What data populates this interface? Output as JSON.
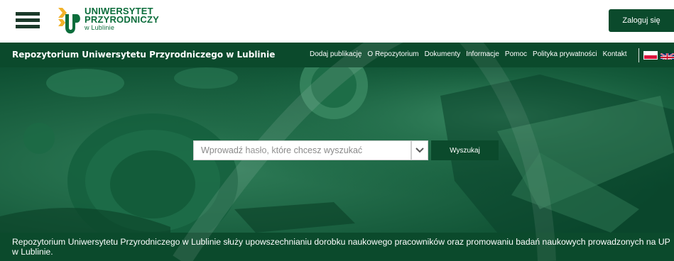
{
  "header": {
    "logo": {
      "line1": "UNIWERSYTET",
      "line2": "PRZYRODNICZY",
      "line3": "w Lublinie",
      "icon": "up-logo-icon"
    },
    "menu_icon": "hamburger-icon",
    "login_label": "Zaloguj się"
  },
  "navbar": {
    "site_title": "Repozytorium Uniwersytetu Przyrodniczego w Lublinie",
    "links": [
      "Dodaj publikację",
      "O Repozytorium",
      "Dokumenty",
      "Informacje",
      "Pomoc",
      "Polityka prywatności",
      "Kontakt"
    ],
    "languages": [
      "pl-flag-icon",
      "uk-flag-icon"
    ]
  },
  "search": {
    "placeholder": "Wprowadź hasło, które chcesz wyszukać",
    "dropdown_icon": "chevron-down-icon",
    "button_label": "Wyszukaj"
  },
  "description": {
    "text": "Repozytorium Uniwersytetu Przyrodniczego w Lublinie służy upowszechnianiu dorobku naukowego pracowników oraz promowaniu badań naukowych prowadzonych na UP w Lublinie."
  },
  "colors": {
    "brand_dark": "#0b4a2c",
    "brand_green": "#0b6d3b",
    "logo_yellow": "#f2b22a",
    "flag_red": "#dc143c"
  }
}
